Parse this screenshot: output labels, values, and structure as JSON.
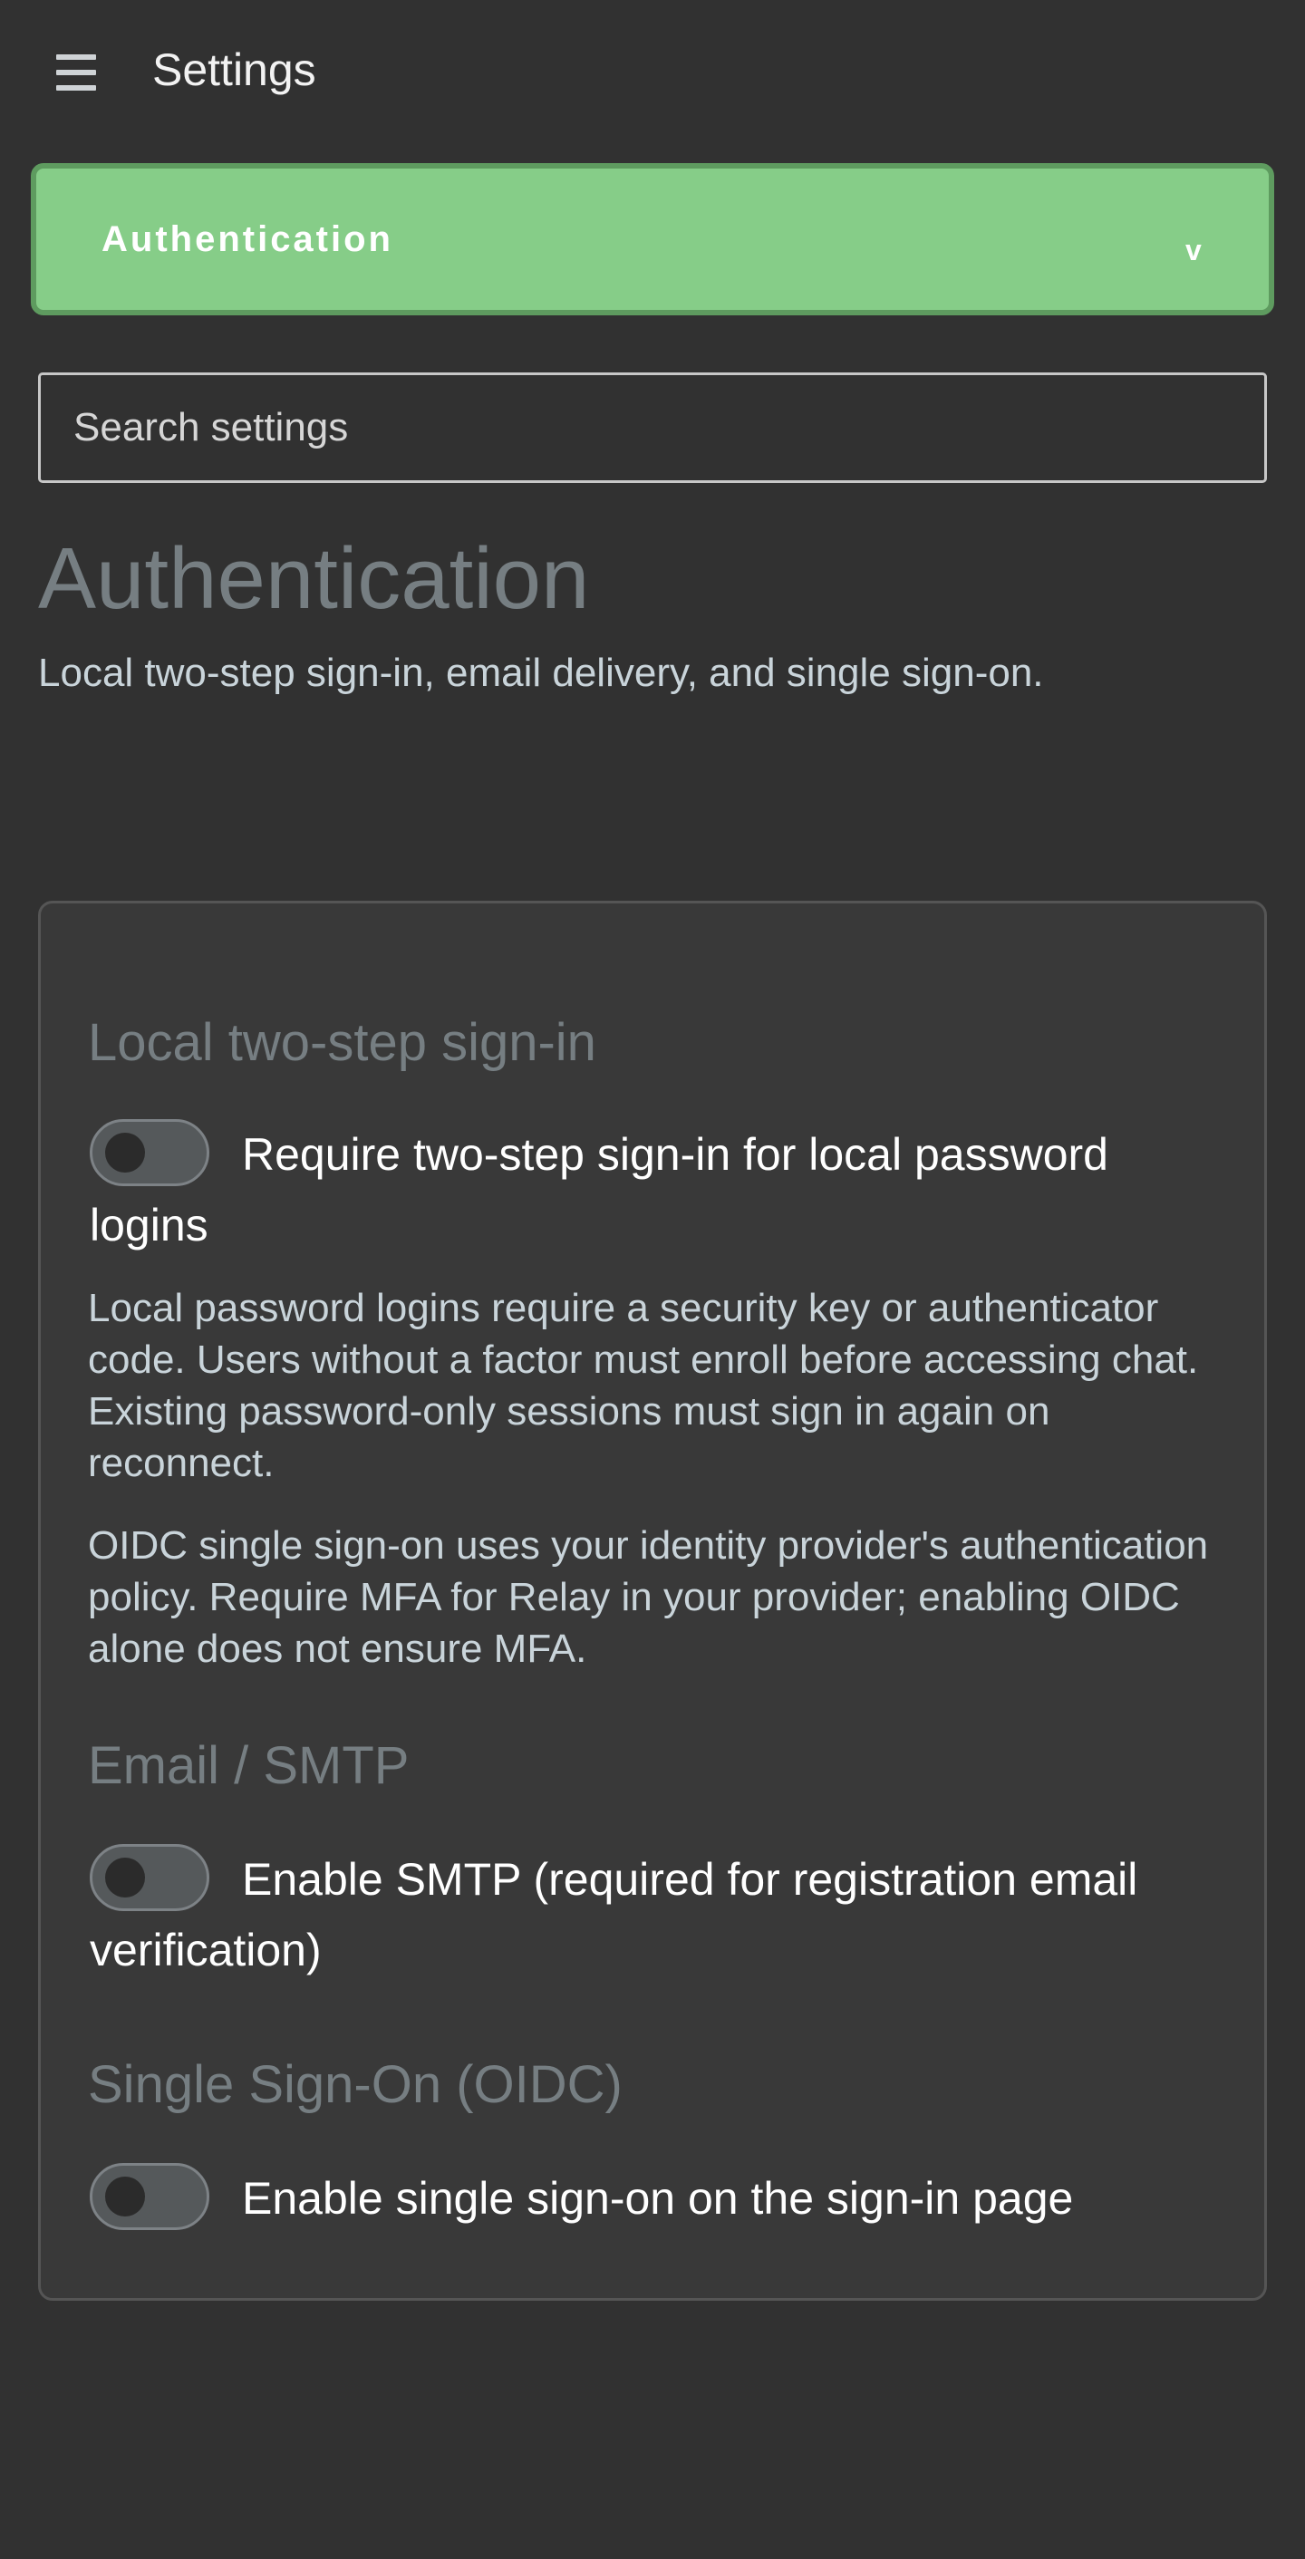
{
  "header": {
    "title": "Settings",
    "menu_icon": "hamburger-menu-icon"
  },
  "section_selector": {
    "selected": "Authentication",
    "chevron": "v",
    "accent_color": "#86cd88"
  },
  "search": {
    "placeholder": "Search settings",
    "value": ""
  },
  "page": {
    "title": "Authentication",
    "subtitle": "Local two-step sign-in, email delivery, and single sign-on."
  },
  "sections": {
    "local": {
      "heading": "Local two-step sign-in",
      "toggle_label": "Require two-step sign-in for local password logins",
      "toggle_on": false,
      "help_1": "Local password logins require a security key or authenticator code. Users without a factor must enroll before accessing chat. Existing password-only sessions must sign in again on reconnect.",
      "help_2": "OIDC single sign-on uses your identity provider's authentication policy. Require MFA for Relay in your provider; enabling OIDC alone does not ensure MFA."
    },
    "smtp": {
      "heading": "Email / SMTP",
      "toggle_label": "Enable SMTP (required for registration email verification)",
      "toggle_on": false
    },
    "oidc": {
      "heading": "Single Sign-On (OIDC)",
      "toggle_label": "Enable single sign-on on the sign-in page",
      "toggle_on": false
    }
  }
}
